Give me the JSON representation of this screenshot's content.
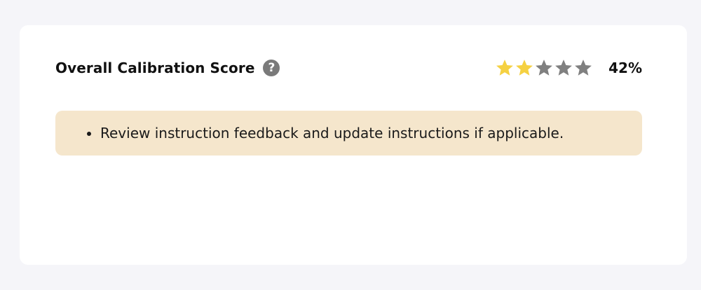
{
  "score_card": {
    "title": "Overall Calibration Score",
    "help_icon": "question-circle-icon",
    "rating": {
      "stars_total": 5,
      "stars_filled": 2,
      "filled_color": "#f5d142",
      "empty_color": "#808080"
    },
    "score_text": "42%"
  },
  "notice": {
    "background_color": "#f5e6cc",
    "items": [
      "Review instruction feedback and update instructions if applicable."
    ]
  }
}
